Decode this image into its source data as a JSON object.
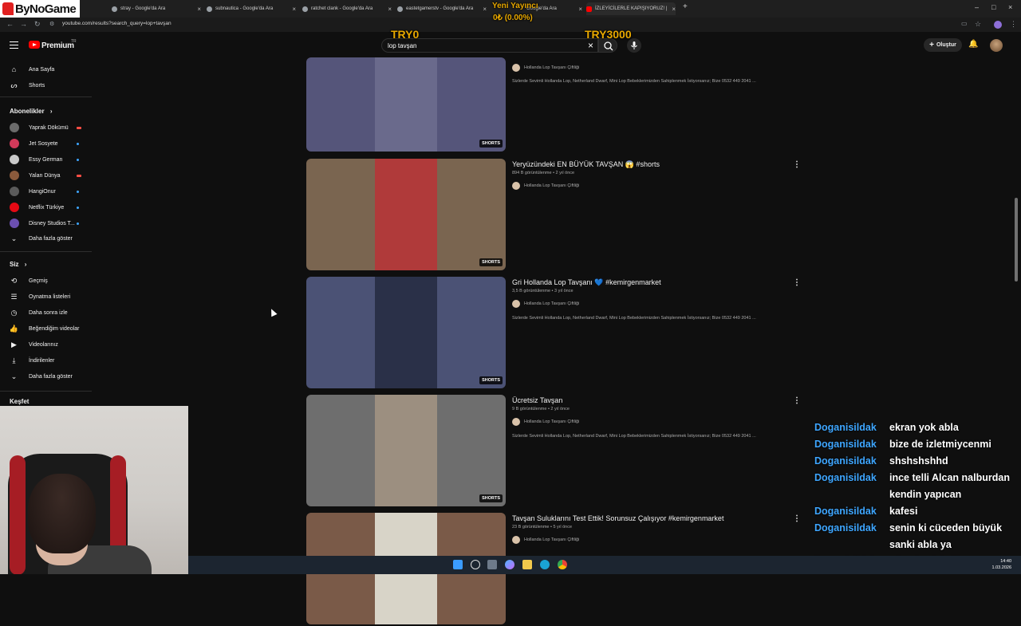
{
  "browser": {
    "tabs": [
      {
        "label": "stray - Google'da Ara"
      },
      {
        "label": "subnautica - Google'da Ara"
      },
      {
        "label": "ratchet clank - Google'da Ara"
      },
      {
        "label": "eastetgamerstv - Google'da Ara"
      },
      {
        "label": "Google'da Ara"
      },
      {
        "label": "İZLEYİCİLERLE KAPIŞIYORUZ! |"
      }
    ],
    "url": "youtube.com/results?search_query=lop+tavşan"
  },
  "youtube": {
    "brand": "Premium",
    "country_code": "TR",
    "search_query": "lop tavşan",
    "create_label": "Oluştur"
  },
  "sidebar": {
    "main": [
      {
        "label": "Ana Sayfa",
        "icon": "home-icon"
      },
      {
        "label": "Shorts",
        "icon": "shorts-icon"
      }
    ],
    "subscriptions_header": "Abonelikler",
    "subscriptions": [
      {
        "label": "Yaprak Dökümü",
        "status": "live",
        "color": "#6b6b6b"
      },
      {
        "label": "Jet Sosyete",
        "status": "new",
        "color": "#d13a5a"
      },
      {
        "label": "Essy German",
        "status": "new",
        "color": "#c9c9c9"
      },
      {
        "label": "Yalan Dünya",
        "status": "live",
        "color": "#8a5a3c"
      },
      {
        "label": "HangiOnur",
        "status": "new",
        "color": "#5a5a5a"
      },
      {
        "label": "Netflix Türkiye",
        "status": "new",
        "color": "#e50914"
      },
      {
        "label": "Disney Studios T...",
        "status": "new",
        "color": "#6b4fb0"
      }
    ],
    "sub_more": "Daha fazla göster",
    "you_header": "Siz",
    "you_items": [
      {
        "label": "Geçmiş",
        "icon": "history-icon"
      },
      {
        "label": "Oynatma listeleri",
        "icon": "playlist-icon"
      },
      {
        "label": "Daha sonra izle",
        "icon": "watch-later-icon"
      },
      {
        "label": "Beğendiğim videolar",
        "icon": "like-icon"
      },
      {
        "label": "Videolarınız",
        "icon": "your-videos-icon"
      },
      {
        "label": "İndirilenler",
        "icon": "download-icon"
      },
      {
        "label": "Daha fazla göster",
        "icon": "chevron-down-icon"
      }
    ],
    "explore_header": "Keşfet"
  },
  "results": [
    {
      "title": "",
      "meta": "",
      "channel": "Hollanda Lop Tavşanı Çiftliği",
      "description": "Sizlerde Sevimli Hollanda Lop, Netherland Dwarf, Mini Lop Bebeklerimizden Sahiplenmek İstiyorsanız; Bize 0532 449 2041 ...",
      "badge": "SHORTS",
      "bg": "#55557a",
      "center": "#6a6a8c"
    },
    {
      "title": "Yeryüzündeki EN BÜYÜK TAVŞAN 😱 #shorts",
      "meta": "894 B görüntülenme • 2 yıl önce",
      "channel": "Hollanda Lop Tavşanı Çiftliği",
      "description": "",
      "badge": "SHORTS",
      "bg": "#7a6550",
      "center": "#b03a3a"
    },
    {
      "title": "Gri Hollanda Lop Tavşanı 💙 #kemirgenmarket",
      "meta": "3,5 B görüntülenme • 3 yıl önce",
      "channel": "Hollanda Lop Tavşanı Çiftliği",
      "description": "Sizlerde Sevimli Hollanda Lop, Netherland Dwarf, Mini Lop Bebeklerimizden Sahiplenmek İstiyorsanız; Bize 0532 449 2041 ...",
      "badge": "SHORTS",
      "bg": "#4b5275",
      "center": "#2a3048"
    },
    {
      "title": "Ücretsiz Tavşan",
      "meta": "9 B görüntülenme • 2 yıl önce",
      "channel": "Hollanda Lop Tavşanı Çiftliği",
      "description": "Sizlerde Sevimli Hollanda Lop, Netherland Dwarf, Mini Lop Bebeklerimizden Sahiplenmek İstiyorsanız; Bize 0532 449 2041 ...",
      "badge": "SHORTS",
      "bg": "#6e6e6e",
      "center": "#9c8f80"
    },
    {
      "title": "Tavşan Suluklarını Test Ettik! Sorunsuz Çalışıyor #kemirgenmarket",
      "meta": "23 B görüntülenme • 5 yıl önce",
      "channel": "Hollanda Lop Tavşanı Çiftliği",
      "description": "",
      "badge": "",
      "bg": "#7a5a48",
      "center": "#d8d4c8"
    }
  ],
  "overlay": {
    "logo_text": "ByNoGame",
    "goal_title": "Yeni Yayıncı",
    "goal_amount": "0₺ (0.00%)",
    "goal_min": "TRY0",
    "goal_max": "TRY3000"
  },
  "chat": [
    {
      "user": "Doganisildak",
      "msg": "ekran yok abla"
    },
    {
      "user": "Doganisildak",
      "msg": "bize de izletmiycenmi"
    },
    {
      "user": "Doganisildak",
      "msg": "shshshshhd"
    },
    {
      "user": "Doganisildak",
      "msg": "ince telli Alcan nalburdan"
    },
    {
      "user": "",
      "msg": "kendin yapıcan"
    },
    {
      "user": "Doganisildak",
      "msg": "kafesi"
    },
    {
      "user": "Doganisildak",
      "msg": "senin ki cüceden büyük"
    },
    {
      "user": "",
      "msg": "sanki abla ya"
    },
    {
      "user": "Doganisildak",
      "msg": "cüceden büyük"
    }
  ],
  "taskbar": {
    "time": "14:40",
    "date": "1.03.2026"
  }
}
